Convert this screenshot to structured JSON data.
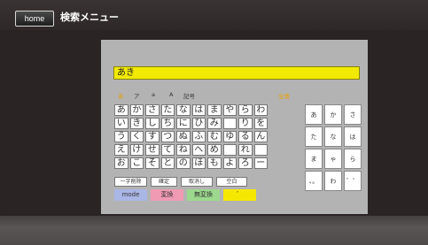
{
  "header": {
    "home_label": "home",
    "title": "検索メニュー"
  },
  "input": {
    "value": "あき"
  },
  "modes": {
    "items": [
      "あ",
      "ア",
      "a",
      "A",
      "記号"
    ],
    "active": "あ",
    "all_label": "全角"
  },
  "kana_rows": [
    [
      "あ",
      "か",
      "さ",
      "た",
      "な",
      "は",
      "ま",
      "や",
      "ら",
      "わ"
    ],
    [
      "い",
      "き",
      "し",
      "ち",
      "に",
      "ひ",
      "み",
      "",
      "り",
      "を"
    ],
    [
      "う",
      "く",
      "す",
      "つ",
      "ぬ",
      "ふ",
      "む",
      "ゆ",
      "る",
      "ん"
    ],
    [
      "え",
      "け",
      "せ",
      "て",
      "ね",
      "へ",
      "め",
      "",
      "れ",
      ""
    ],
    [
      "お",
      "こ",
      "そ",
      "と",
      "の",
      "ほ",
      "も",
      "よ",
      "ろ",
      "ー"
    ]
  ],
  "ten_pad": [
    [
      "あ",
      "か",
      "さ"
    ],
    [
      "た",
      "な",
      "は"
    ],
    [
      "ま",
      "ゃ",
      "ら"
    ],
    [
      "、。",
      "わ",
      "゛゜"
    ]
  ],
  "functions": [
    "一字削除",
    "確定",
    "取消し",
    "空白"
  ],
  "color_buttons": [
    {
      "label": "mode",
      "color": "#a9b6e6"
    },
    {
      "label": "変換",
      "color": "#f09ab4"
    },
    {
      "label": "無変換",
      "color": "#9cd88e"
    },
    {
      "label": "゛",
      "color": "#f5e800"
    }
  ]
}
